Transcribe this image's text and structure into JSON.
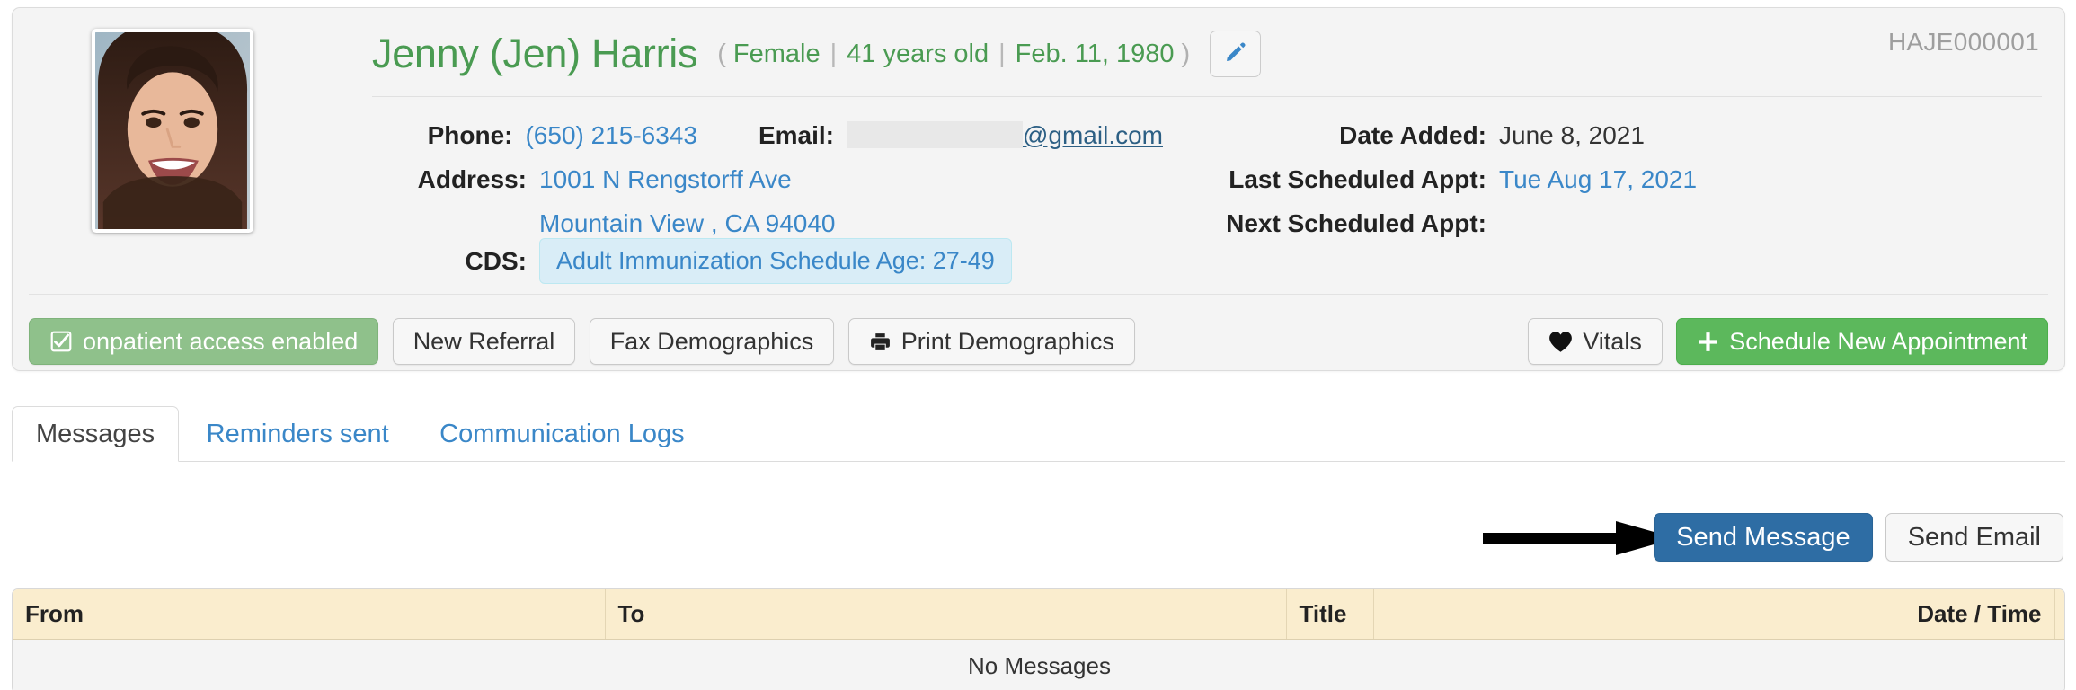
{
  "patient": {
    "name": "Jenny (Jen) Harris",
    "paren_open": "(",
    "paren_close": ")",
    "gender": "Female",
    "age": "41 years old",
    "dob": "Feb. 11, 1980",
    "separator": "|",
    "chart_id": "HAJE000001",
    "edit_icon": "pencil-icon",
    "avatar_alt": "patient-photo"
  },
  "info": {
    "phone_label": "Phone:",
    "phone_value": "(650) 215-6343",
    "email_label": "Email:",
    "email_redacted": "",
    "email_value": "@gmail.com",
    "address_label": "Address:",
    "address_line1": "1001 N Rengstorff Ave",
    "address_line2": "Mountain View , CA 94040",
    "cds_label": "CDS:",
    "cds_value": "Adult Immunization Schedule Age: 27-49",
    "date_added_label": "Date Added:",
    "date_added_value": "June 8, 2021",
    "last_appt_label": "Last Scheduled Appt:",
    "last_appt_value": "Tue Aug 17, 2021",
    "next_appt_label": "Next Scheduled Appt:",
    "next_appt_value": ""
  },
  "actions": {
    "onpatient": "onpatient access enabled",
    "new_referral": "New Referral",
    "fax_demographics": "Fax Demographics",
    "print_demographics": "Print Demographics",
    "vitals": "Vitals",
    "schedule": "Schedule New Appointment"
  },
  "tabs": [
    {
      "label": "Messages",
      "active": true
    },
    {
      "label": "Reminders sent",
      "active": false
    },
    {
      "label": "Communication Logs",
      "active": false
    }
  ],
  "send": {
    "message": "Send Message",
    "email": "Send Email"
  },
  "table": {
    "columns": [
      "From",
      "To",
      "",
      "Title",
      "",
      "Date / Time",
      ""
    ],
    "empty_text": "No Messages"
  },
  "colors": {
    "name_green": "#4a9b52",
    "link_blue": "#3a87c8",
    "primary_blue": "#2e6da4",
    "success_green": "#5cb85c",
    "onpatient_green": "#8fc18b",
    "table_header": "#faedce",
    "panel_bg": "#f4f4f4"
  }
}
